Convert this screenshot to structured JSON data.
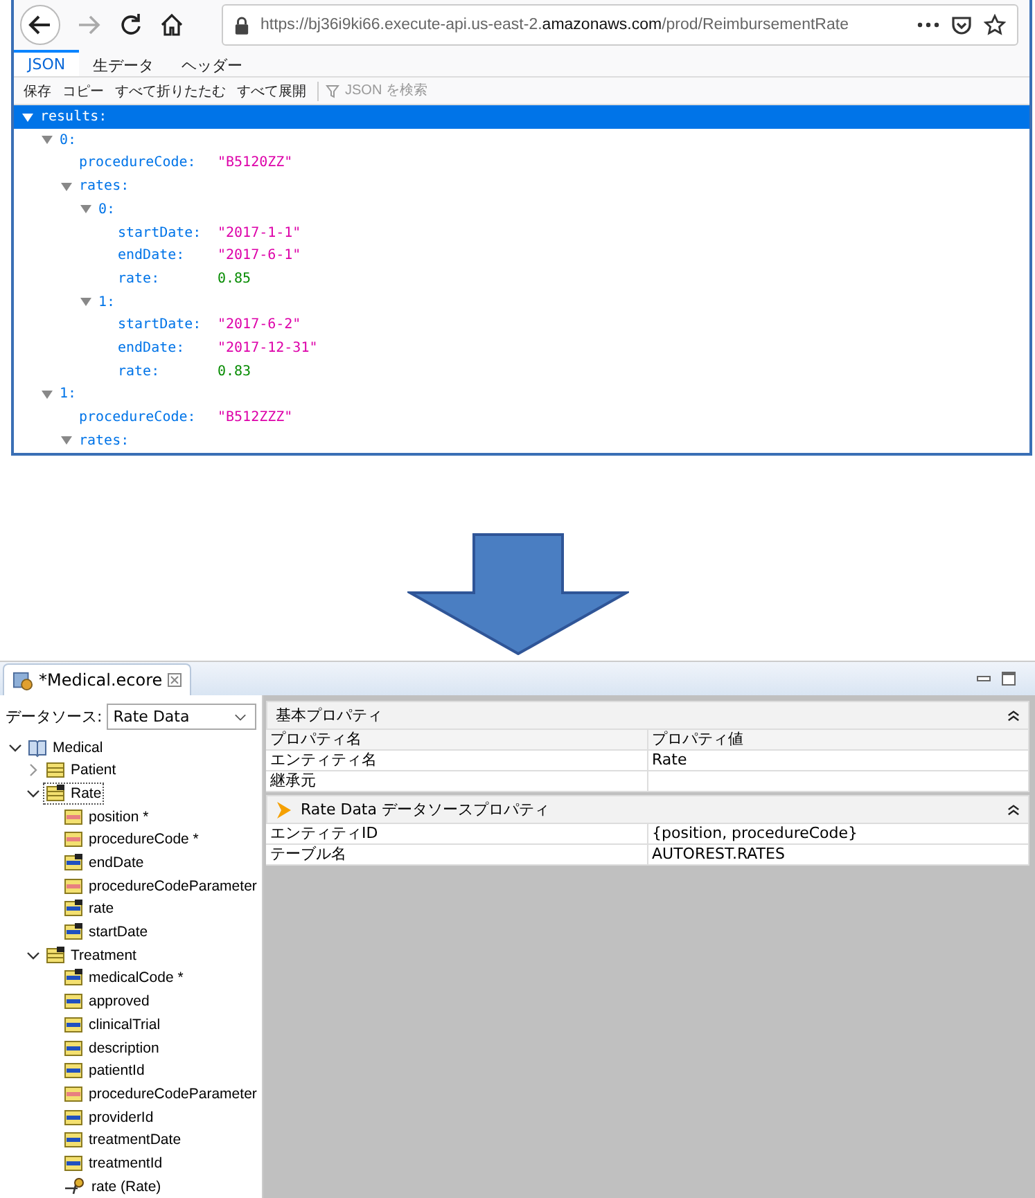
{
  "browser": {
    "nav": [
      {
        "kind": "back",
        "disabled": false
      },
      {
        "kind": "forward",
        "disabled": true
      },
      {
        "kind": "reload",
        "disabled": false
      },
      {
        "kind": "home",
        "disabled": false
      }
    ],
    "url": {
      "prefix": "https://bj36i9ki66.execute-api.us-east-2.",
      "domain": "amazonaws.com",
      "path": "/prod/ReimbursementRate"
    },
    "tabs": [
      {
        "label": "JSON",
        "selected": true
      },
      {
        "label": "生データ",
        "selected": false
      },
      {
        "label": "ヘッダー",
        "selected": false
      }
    ],
    "toolbar": [
      "保存",
      "コピー",
      "すべて折りたたむ",
      "すべて展開"
    ],
    "filter": {
      "placeholder": "JSON を検索"
    },
    "tree": [
      {
        "key": "results:",
        "expanded": true,
        "selected": true,
        "children": [
          {
            "key": "0:",
            "expanded": true,
            "selected": false,
            "children": [
              {
                "key": "procedureCode:",
                "value": "\"B5120ZZ\"",
                "kind": "string",
                "selected": false
              },
              {
                "key": "rates:",
                "expanded": true,
                "selected": false,
                "children": [
                  {
                    "key": "0:",
                    "expanded": true,
                    "selected": false,
                    "children": [
                      {
                        "key": "startDate:",
                        "value": "\"2017-1-1\"",
                        "kind": "string",
                        "selected": false
                      },
                      {
                        "key": "endDate:",
                        "value": "\"2017-6-1\"",
                        "kind": "string",
                        "selected": false
                      },
                      {
                        "key": "rate:",
                        "value": "0.85",
                        "kind": "number",
                        "selected": false
                      }
                    ]
                  },
                  {
                    "key": "1:",
                    "expanded": true,
                    "selected": false,
                    "children": [
                      {
                        "key": "startDate:",
                        "value": "\"2017-6-2\"",
                        "kind": "string",
                        "selected": false
                      },
                      {
                        "key": "endDate:",
                        "value": "\"2017-12-31\"",
                        "kind": "string",
                        "selected": false
                      },
                      {
                        "key": "rate:",
                        "value": "0.83",
                        "kind": "number",
                        "selected": false
                      }
                    ]
                  }
                ]
              }
            ]
          },
          {
            "key": "1:",
            "expanded": true,
            "selected": false,
            "children": [
              {
                "key": "procedureCode:",
                "value": "\"B512ZZZ\"",
                "kind": "string",
                "selected": false
              },
              {
                "key": "rates:",
                "expanded": true,
                "selected": false
              }
            ]
          }
        ]
      }
    ]
  },
  "editor": {
    "tab": {
      "title": "*Medical.ecore",
      "selected": true
    },
    "datasource": {
      "label": "データソース:",
      "value": "Rate Data"
    },
    "tree": [
      {
        "label": "Medical",
        "kind": "package",
        "expanded": true,
        "selected": false,
        "children": [
          {
            "label": "Patient",
            "kind": "class",
            "expanded": false,
            "selected": false
          },
          {
            "label": "Rate",
            "kind": "mapped-class",
            "expanded": true,
            "selected": true,
            "children": [
              {
                "label": "position *",
                "kind": "parameter",
                "selected": false
              },
              {
                "label": "procedureCode *",
                "kind": "parameter",
                "selected": false
              },
              {
                "label": "endDate",
                "kind": "mapped-attribute",
                "selected": false
              },
              {
                "label": "procedureCodeParameter",
                "kind": "parameter",
                "selected": false
              },
              {
                "label": "rate",
                "kind": "mapped-attribute",
                "selected": false
              },
              {
                "label": "startDate",
                "kind": "mapped-attribute",
                "selected": false
              }
            ]
          },
          {
            "label": "Treatment",
            "kind": "mapped-class",
            "expanded": true,
            "selected": false,
            "children": [
              {
                "label": "medicalCode *",
                "kind": "mapped-attribute",
                "selected": false
              },
              {
                "label": "approved",
                "kind": "attribute",
                "selected": false
              },
              {
                "label": "clinicalTrial",
                "kind": "attribute",
                "selected": false
              },
              {
                "label": "description",
                "kind": "attribute",
                "selected": false
              },
              {
                "label": "patientId",
                "kind": "attribute",
                "selected": false
              },
              {
                "label": "procedureCodeParameter",
                "kind": "parameter",
                "selected": false
              },
              {
                "label": "providerId",
                "kind": "attribute",
                "selected": false
              },
              {
                "label": "treatmentDate",
                "kind": "attribute",
                "selected": false
              },
              {
                "label": "treatmentId",
                "kind": "attribute",
                "selected": false
              },
              {
                "label": "rate (Rate)",
                "kind": "reference",
                "selected": false
              }
            ]
          }
        ]
      }
    ],
    "sections": [
      {
        "title": "基本プロパティ",
        "kind": "plain",
        "expanded": true,
        "header": [
          "プロパティ名",
          "プロパティ値"
        ],
        "rows": [
          [
            "エンティティ名",
            "Rate"
          ],
          [
            "継承元",
            ""
          ]
        ]
      },
      {
        "title": "Rate Data データソースプロパティ",
        "kind": "datasource",
        "expanded": true,
        "rows": [
          [
            "エンティティID",
            "{position, procedureCode}"
          ],
          [
            "テーブル名",
            "AUTOREST.RATES"
          ]
        ]
      }
    ]
  }
}
